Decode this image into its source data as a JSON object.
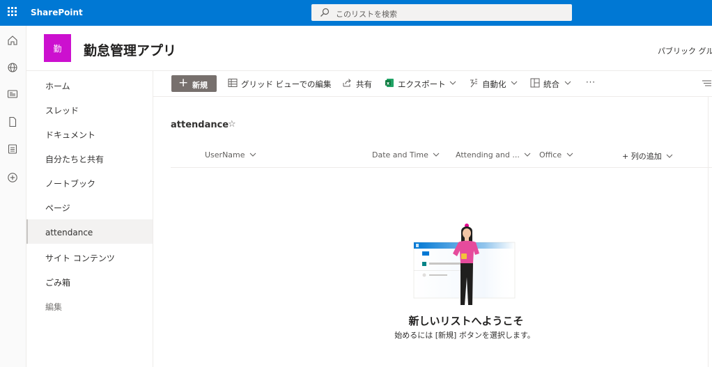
{
  "app": {
    "brand": "SharePoint",
    "search_placeholder": "このリストを検索"
  },
  "site": {
    "logo_text": "勤",
    "logo_color": "#cc10cf",
    "title": "勤怠管理アプリ",
    "group_label": "パブリック グル"
  },
  "leftnav": {
    "items": [
      {
        "label": "ホーム"
      },
      {
        "label": "スレッド"
      },
      {
        "label": "ドキュメント"
      },
      {
        "label": "自分たちと共有"
      },
      {
        "label": "ノートブック"
      },
      {
        "label": "ページ"
      },
      {
        "label": "attendance"
      },
      {
        "label": "サイト コンテンツ"
      },
      {
        "label": "ごみ箱"
      },
      {
        "label": "編集"
      }
    ],
    "active": "attendance"
  },
  "commandbar": {
    "new_label": "新規",
    "grid_edit_label": "グリッド ビューでの編集",
    "share_label": "共有",
    "export_label": "エクスポート",
    "automate_label": "自動化",
    "integrate_label": "統合",
    "more_label": "···"
  },
  "list": {
    "title": "attendance",
    "columns": [
      "UserName",
      "Date and Time",
      "Attending and ...",
      "Office"
    ],
    "add_column_label": "+ 列の追加"
  },
  "empty_state": {
    "title": "新しいリストへようこそ",
    "subtitle": "始めるには [新規] ボタンを選択します。"
  },
  "colors": {
    "suite_bar": "#0078d4",
    "new_button": "#77706d",
    "excel_green": "#107c41"
  }
}
